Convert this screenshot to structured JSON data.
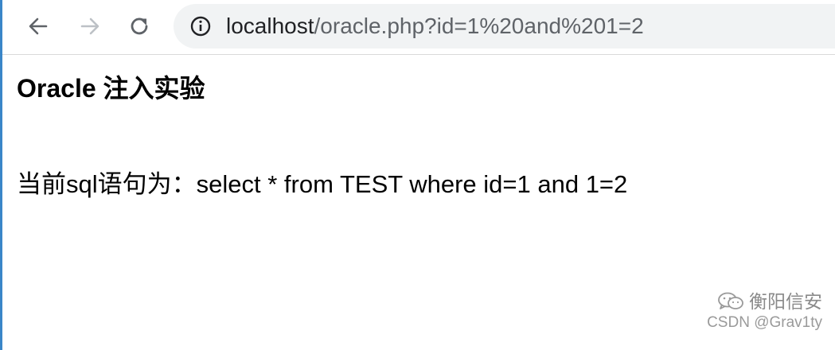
{
  "browser": {
    "url_host": "localhost",
    "url_rest": "/oracle.php?id=1%20and%201=2",
    "icons": [
      "back-arrow-icon",
      "forward-arrow-icon",
      "reload-icon",
      "info-icon"
    ]
  },
  "page": {
    "heading": "Oracle 注入实验",
    "sql_line": "当前sql语句为：select * from TEST where id=1 and 1=2"
  },
  "watermark": {
    "account": "衡阳信安",
    "csdn": "CSDN @Grav1ty",
    "icon": "wechat-icon"
  }
}
